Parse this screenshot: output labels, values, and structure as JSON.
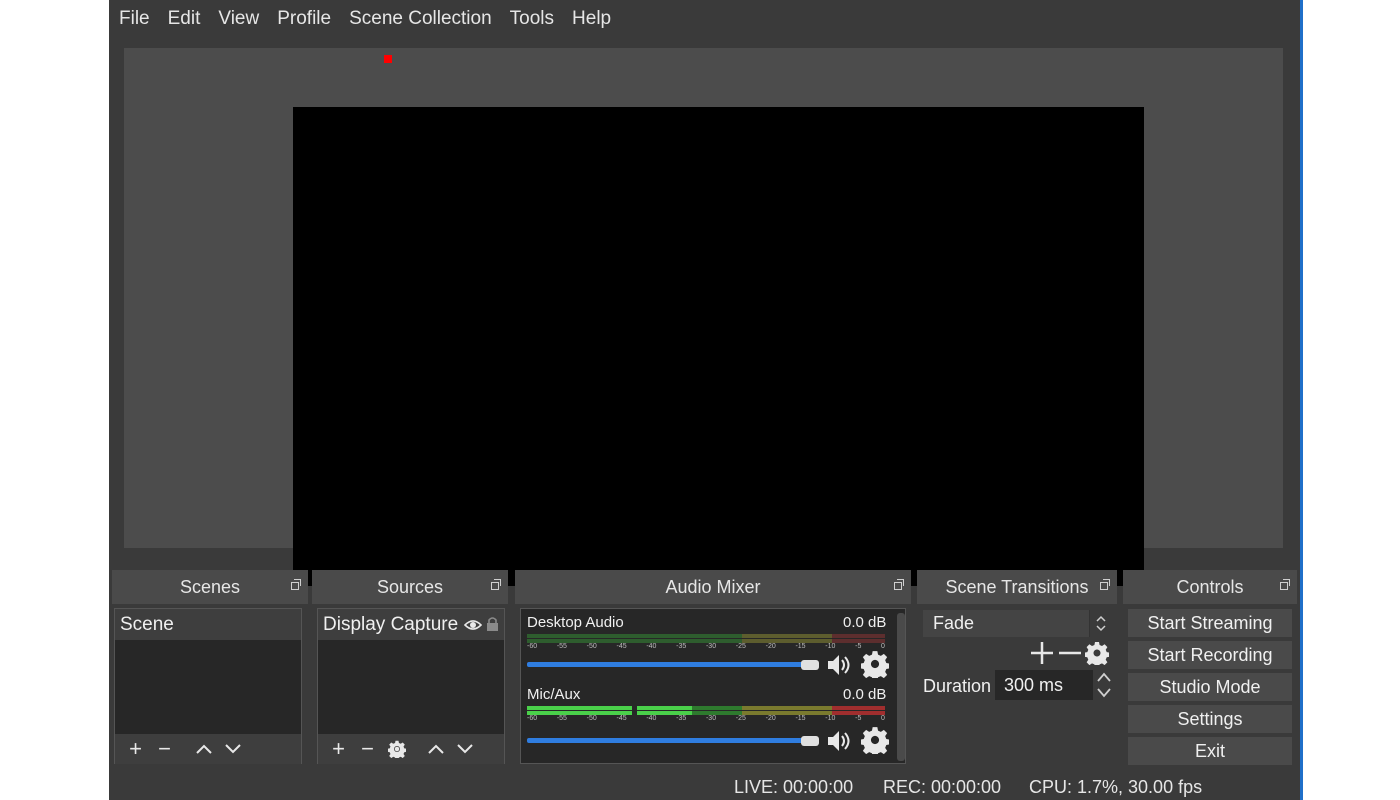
{
  "menu": [
    "File",
    "Edit",
    "View",
    "Profile",
    "Scene Collection",
    "Tools",
    "Help"
  ],
  "docks": {
    "scenes": {
      "title": "Scenes",
      "items": [
        "Scene"
      ]
    },
    "sources": {
      "title": "Sources",
      "items": [
        "Display Capture"
      ]
    },
    "audio_mixer": {
      "title": "Audio Mixer",
      "channels": [
        {
          "name": "Desktop Audio",
          "db": "0.0 dB",
          "volume": 1.0
        },
        {
          "name": "Mic/Aux",
          "db": "0.0 dB",
          "volume": 1.0
        }
      ],
      "scale": [
        "-60",
        "-55",
        "-50",
        "-45",
        "-40",
        "-35",
        "-30",
        "-25",
        "-20",
        "-15",
        "-10",
        "-5",
        "0"
      ]
    },
    "scene_transitions": {
      "title": "Scene Transitions",
      "transition": "Fade",
      "duration_label": "Duration",
      "duration_value": "300 ms"
    },
    "controls": {
      "title": "Controls",
      "buttons": [
        "Start Streaming",
        "Start Recording",
        "Studio Mode",
        "Settings",
        "Exit"
      ]
    }
  },
  "status": {
    "live": "LIVE: 00:00:00",
    "rec": "REC: 00:00:00",
    "cpu": "CPU: 1.7%, 30.00 fps"
  },
  "colors": {
    "background": "#3a3a3a",
    "preview_bg": "#4c4c4c",
    "canvas": "#000000",
    "accent_blue": "#2f7de0",
    "meter_green": "#4ad04a",
    "meter_yellow": "#c8c840",
    "meter_red": "#d03a3a"
  }
}
